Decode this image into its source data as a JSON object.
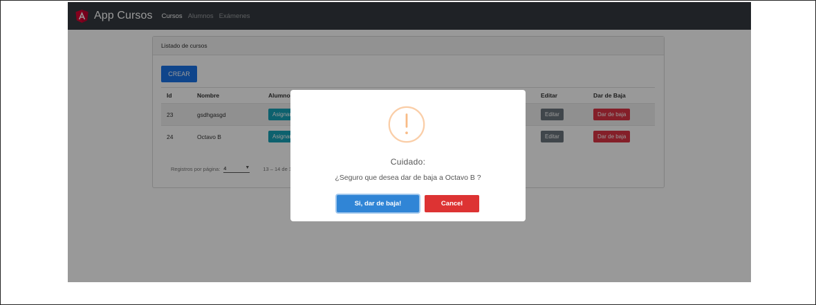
{
  "navbar": {
    "brand": "App Cursos",
    "links": [
      "Cursos",
      "Alumnos",
      "Exámenes"
    ],
    "colors": {
      "background": "#343a40",
      "logo": "#dd0031"
    }
  },
  "card": {
    "header": "Listado de cursos",
    "create_button": "CREAR",
    "table": {
      "headers": [
        "Id",
        "Nombre",
        "Alumnos",
        "",
        "",
        "Editar",
        "Dar de Baja"
      ],
      "rows": [
        {
          "id": "23",
          "nombre": "gsdhgasgd",
          "assign_button": "Asignar",
          "edit_button": "Editar",
          "delete_button": "Dar de baja"
        },
        {
          "id": "24",
          "nombre": "Octavo B",
          "assign_button": "Asignar",
          "edit_button": "Editar",
          "delete_button": "Dar de baja"
        }
      ]
    },
    "paginator": {
      "label": "Registros por página:",
      "page_size": "4",
      "range": "13 – 14 de 14"
    }
  },
  "modal": {
    "icon": "warning-icon",
    "title": "Cuidado:",
    "text": "¿Seguro que desea dar de baja a Octavo B ?",
    "confirm_label": "Si, dar de baja!",
    "cancel_label": "Cancel",
    "colors": {
      "confirm": "#3085d6",
      "cancel": "#dd3333",
      "warning": "#facea8"
    }
  }
}
